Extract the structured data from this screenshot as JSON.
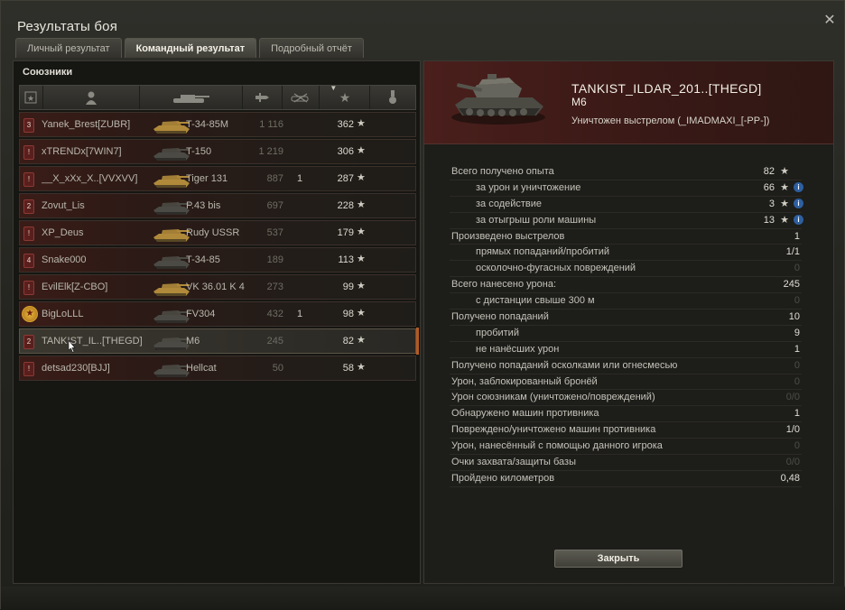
{
  "window": {
    "title": "Результаты боя",
    "close_glyph": "✕"
  },
  "tabs": [
    {
      "label": "Личный результат",
      "active": false
    },
    {
      "label": "Командный результат",
      "active": true
    },
    {
      "label": "Подробный отчёт",
      "active": false
    }
  ],
  "left": {
    "section_label": "Союзники",
    "columns": [
      {
        "icon": "rank-star-icon"
      },
      {
        "icon": "player-silhouette-icon"
      },
      {
        "icon": "tank-silhouette-icon"
      },
      {
        "icon": "damage-shell-icon"
      },
      {
        "icon": "destroyed-tank-icon"
      },
      {
        "icon": "experience-star-icon"
      },
      {
        "icon": "medal-icon"
      }
    ],
    "players": [
      {
        "rank": "3",
        "name": "Yanek_Brest[ZUBR]",
        "tank": "T-34-85M",
        "damage": "1 116",
        "kills": "",
        "xp": "362",
        "icon_color": "#b08a3a"
      },
      {
        "rank": "!",
        "name": "xTRENDx[7WIN7]",
        "tank": "T-150",
        "damage": "1 219",
        "kills": "",
        "xp": "306",
        "icon_color": "#4b4a44"
      },
      {
        "rank": "!",
        "name": "__X_xXx_X..[VVXVV]",
        "tank": "Tiger 131",
        "damage": "887",
        "kills": "1",
        "xp": "287",
        "icon_color": "#b08a3a"
      },
      {
        "rank": "2",
        "name": "Zovut_Lis",
        "tank": "P.43 bis",
        "damage": "697",
        "kills": "",
        "xp": "228",
        "icon_color": "#4b4a44"
      },
      {
        "rank": "!",
        "name": "XP_Deus",
        "tank": "Rudy USSR",
        "damage": "537",
        "kills": "",
        "xp": "179",
        "icon_color": "#b08a3a"
      },
      {
        "rank": "4",
        "name": "Snake000",
        "tank": "T-34-85",
        "damage": "189",
        "kills": "",
        "xp": "113",
        "icon_color": "#4b4a44"
      },
      {
        "rank": "!",
        "name": "EvilElk[Z-CBO]",
        "tank": "VK 36.01 K 4",
        "damage": "273",
        "kills": "",
        "xp": "99",
        "icon_color": "#b08a3a"
      },
      {
        "rank": "★",
        "name": "BigLoLLL",
        "tank": "FV304",
        "damage": "432",
        "kills": "1",
        "xp": "98",
        "icon_color": "#4b4a44"
      },
      {
        "rank": "2",
        "name": "TANKIST_IL..[THEGD]",
        "tank": "M6",
        "damage": "245",
        "kills": "",
        "xp": "82",
        "icon_color": "#4b4a44"
      },
      {
        "rank": "!",
        "name": "detsad230[BJJ]",
        "tank": "Hellcat",
        "damage": "50",
        "kills": "",
        "xp": "58",
        "icon_color": "#4b4a44"
      }
    ]
  },
  "right": {
    "player_name": "TANKIST_ILDAR_201..[THEGD]",
    "tank": "M6",
    "killed_by": "Уничтожен выстрелом (_IMADMAXI_[-PP-])",
    "stats": [
      {
        "label": "Всего получено опыта",
        "value": "82",
        "sub": false,
        "star": true,
        "info": false,
        "dim": false
      },
      {
        "label": "за урон и уничтожение",
        "value": "66",
        "sub": true,
        "star": true,
        "info": true,
        "dim": false
      },
      {
        "label": "за содействие",
        "value": "3",
        "sub": true,
        "star": true,
        "info": true,
        "dim": false
      },
      {
        "label": "за отыгрыш роли машины",
        "value": "13",
        "sub": true,
        "star": true,
        "info": true,
        "dim": false
      },
      {
        "label": "Произведено выстрелов",
        "value": "1",
        "sub": false,
        "star": false,
        "info": false,
        "dim": false
      },
      {
        "label": "прямых попаданий/пробитий",
        "value": "1/1",
        "sub": true,
        "star": false,
        "info": false,
        "dim": false
      },
      {
        "label": "осколочно-фугасных повреждений",
        "value": "0",
        "sub": true,
        "star": false,
        "info": false,
        "dim": true
      },
      {
        "label": "Всего нанесено урона:",
        "value": "245",
        "sub": false,
        "star": false,
        "info": false,
        "dim": false
      },
      {
        "label": "с дистанции свыше 300 м",
        "value": "0",
        "sub": true,
        "star": false,
        "info": false,
        "dim": true
      },
      {
        "label": "Получено попаданий",
        "value": "10",
        "sub": false,
        "star": false,
        "info": false,
        "dim": false
      },
      {
        "label": "пробитий",
        "value": "9",
        "sub": true,
        "star": false,
        "info": false,
        "dim": false
      },
      {
        "label": "не нанёсших урон",
        "value": "1",
        "sub": true,
        "star": false,
        "info": false,
        "dim": false
      },
      {
        "label": "Получено попаданий осколками или огнесмесью",
        "value": "0",
        "sub": false,
        "star": false,
        "info": false,
        "dim": true
      },
      {
        "label": "Урон, заблокированный бронёй",
        "value": "0",
        "sub": false,
        "star": false,
        "info": false,
        "dim": true
      },
      {
        "label": "Урон союзникам (уничтожено/повреждений)",
        "value": "0/0",
        "sub": false,
        "star": false,
        "info": false,
        "dim": true
      },
      {
        "label": "Обнаружено машин противника",
        "value": "1",
        "sub": false,
        "star": false,
        "info": false,
        "dim": false
      },
      {
        "label": "Повреждено/уничтожено машин противника",
        "value": "1/0",
        "sub": false,
        "star": false,
        "info": false,
        "dim": false
      },
      {
        "label": "Урон, нанесённый с помощью данного игрока",
        "value": "0",
        "sub": false,
        "star": false,
        "info": false,
        "dim": true
      },
      {
        "label": "Очки захвата/защиты базы",
        "value": "0/0",
        "sub": false,
        "star": false,
        "info": false,
        "dim": true
      },
      {
        "label": "Пройдено километров",
        "value": "0,48",
        "sub": false,
        "star": false,
        "info": false,
        "dim": false
      }
    ],
    "close_label": "Закрыть"
  },
  "colors": {
    "accent": "#b35a22",
    "hero_bg": "#4a1f1c",
    "info": "#2d5fa0"
  },
  "glyphs": {
    "star": "★",
    "info": "i"
  }
}
